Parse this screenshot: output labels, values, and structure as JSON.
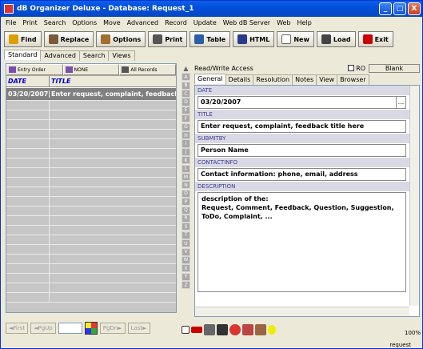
{
  "window": {
    "title": "dB Organizer Deluxe - Database: Request_1",
    "minimize": "_",
    "maximize": "□",
    "close": "X"
  },
  "menu": [
    "File",
    "Print",
    "Search",
    "Options",
    "Move",
    "Advanced",
    "Record",
    "Update",
    "Web dB Server",
    "Web",
    "Help"
  ],
  "toolbar": [
    {
      "label": "Find",
      "icon": "search-icon",
      "color": "#d9a000"
    },
    {
      "label": "Replace",
      "icon": "replace-icon",
      "color": "#7a5a3a"
    },
    {
      "label": "Options",
      "icon": "options-icon",
      "color": "#a07030"
    },
    {
      "label": "Print",
      "icon": "printer-icon",
      "color": "#555"
    },
    {
      "label": "Table",
      "icon": "table-icon",
      "color": "#2a5ea8"
    },
    {
      "label": "HTML",
      "icon": "html-icon",
      "color": "#2a3a8a"
    },
    {
      "label": "New",
      "icon": "new-doc-icon",
      "color": "#fff"
    },
    {
      "label": "Load",
      "icon": "load-icon",
      "color": "#444"
    },
    {
      "label": "Exit",
      "icon": "exit-icon",
      "color": "#c00"
    }
  ],
  "view_tabs": [
    "Standard",
    "Advanced",
    "Search",
    "Views"
  ],
  "sort": {
    "entry_order": "Entry Order",
    "none": "NONE",
    "all_records": "All Records"
  },
  "grid": {
    "col_date": "DATE",
    "col_title": "TITLE",
    "rows": [
      {
        "date": "03/20/2007",
        "title": "Enter request, complaint, feedback"
      }
    ]
  },
  "nav": {
    "first": "First",
    "pgup": "PgUp",
    "pgdn": "PgDn",
    "last": "Last"
  },
  "alpha_index": [
    "A",
    "B",
    "C",
    "D",
    "E",
    "F",
    "G",
    "H",
    "I",
    "J",
    "K",
    "L",
    "M",
    "N",
    "O",
    "P",
    "Q",
    "R",
    "S",
    "T",
    "U",
    "V",
    "W",
    "X",
    "Y",
    "Z"
  ],
  "record": {
    "access": "Read/Write Access",
    "ro_label": "RO",
    "blank_button": "Blank",
    "tabs": [
      "General",
      "Details",
      "Resolution",
      "Notes",
      "View",
      "Browser"
    ],
    "fields": {
      "date_label": "DATE",
      "date_value": "03/20/2007",
      "date_button": "...",
      "title_label": "TITLE",
      "title_value": "Enter request, complaint, feedback title here",
      "submitby_label": "SUBMITBY",
      "submitby_value": "Person Name",
      "contactinfo_label": "CONTACTINFO",
      "contactinfo_value": "Contact information: phone, email, address",
      "description_label": "DESCRIPTION",
      "description_lines": [
        "description of the:",
        "Request, Comment, Feedback, Question, Suggestion,",
        "ToDo, Complaint,  ..."
      ]
    }
  },
  "status": {
    "zoom": "100%",
    "db_name": "request"
  }
}
